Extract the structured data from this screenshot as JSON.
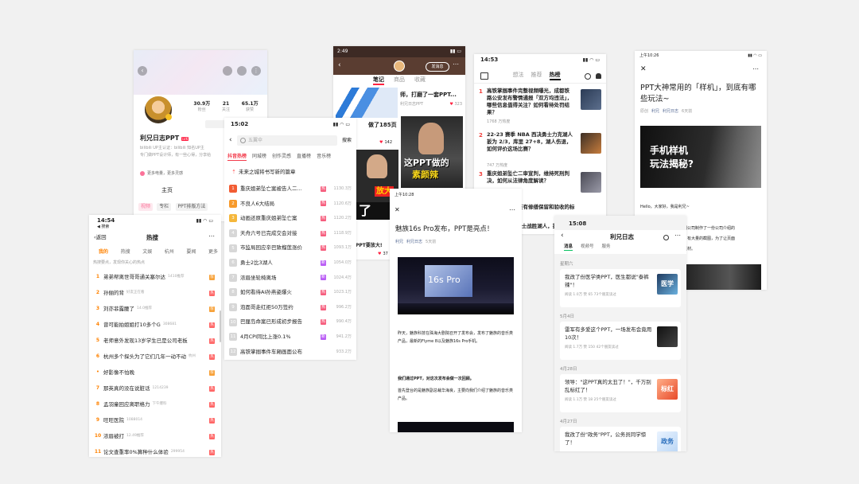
{
  "frame_a": {
    "followers_value": "30.9万",
    "followers_label": "粉丝",
    "following_value": "21",
    "following_label": "关注",
    "likes_value": "65.1万",
    "likes_label": "获赞",
    "name": "利兄日志PPT",
    "level": "LV6",
    "sent_label": "已",
    "desc1": "bilibili UP主认证：bilibili 知名UP主",
    "desc2": "专门做PPT设计师，有一些心得，分享给",
    "notice": "更多电量，更多灵感",
    "tab_home": "主页",
    "tab_dynamic": "动态",
    "chip_video": "视频",
    "chip_column": "专栏",
    "chip_ppt": "PPT排版方法"
  },
  "frame_b": {
    "time": "2:49",
    "follow": "发消息",
    "tab_notes": "笔记",
    "tab_goods": "商品",
    "tab_collect": "收藏",
    "post1_title": "师，打磨了一套PPT...",
    "post1_author": "利兄日志PPT",
    "post1_likes": "323",
    "post2_title": "做了185页",
    "post2_likes": "142",
    "post3_overlay": "这PPT做的",
    "post3_overlay2": "素颜辣",
    "side_red": "放大",
    "side_black": "了",
    "post4_title": "PPT要放大!",
    "post4_likes": "37"
  },
  "frame_c": {
    "time": "14:53",
    "tab_idea": "想法",
    "tab_rec": "推荐",
    "tab_hot": "热榜",
    "items": [
      {
        "rank": "1",
        "title": "高铁掌掴事件完整视频曝光，成都铁路公安发布警情通报「双方均违法」，哪些信息值得关注？如何看待处罚结果？",
        "heat": "1768 万热度"
      },
      {
        "rank": "2",
        "title": "22-23 赛季 NBA 西决勇士力克湖人扳为 2/3，库里 27+8，湖人伤退，如何评价这场比赛？",
        "heat": "747 万热度"
      },
      {
        "rank": "3",
        "title": "重庆姐弟坠亡二审宣判，维持死刑判决，如何从法律角度解读？",
        "heat": ""
      },
      {
        "rank": "4",
        "title": "被砸的小区，还有修缮保留和验收的标准",
        "heat": ""
      },
      {
        "rank": "5",
        "title": "NBA 半决赛勇士战胜湖人，扳回一局，库里",
        "heat": ""
      }
    ]
  },
  "frame_d": {
    "time": "上午10:26",
    "title": "PPT大神常用的「样机」，到底有哪些玩法~",
    "source": "原创",
    "author": "利兄",
    "account": "利兄日志",
    "date": "6天前",
    "cover_line1": "手机样机",
    "cover_line2": "玩法揭秘?",
    "body1": "Hello，大家好，我是利兄~",
    "body2": "网公司制作了一份公司介绍的",
    "body3": "，有大量的截图，为了让页面",
    "body4": "素材。"
  },
  "frame_e": {
    "time": "15:02",
    "search_placeholder": "五翼伞",
    "search_btn": "搜索",
    "tabs": [
      "抖音热榜",
      "同城榜",
      "创作灵感",
      "直播榜",
      "音乐榜"
    ],
    "top_item": "未来之城将书写新的篇章",
    "items": [
      {
        "rank": "1",
        "title": "重庆姐弟坠亡案被告人二...",
        "heat": "1130.3万",
        "badge": "热"
      },
      {
        "rank": "2",
        "title": "不良人6大结局",
        "heat": "1120.6万",
        "badge": "热"
      },
      {
        "rank": "3",
        "title": "动画还原重庆姐弟坠亡案",
        "heat": "1120.2万",
        "badge": "热"
      },
      {
        "rank": "4",
        "title": "天舟六号已完成交会对接",
        "heat": "1118.9万",
        "badge": "热"
      },
      {
        "rank": "5",
        "title": "市监局回应辛巴致榴莲涨价",
        "heat": "1093.1万",
        "badge": "热"
      },
      {
        "rank": "6",
        "title": "勇士2比3湖人",
        "heat": "1054.0万",
        "badge": "新"
      },
      {
        "rank": "7",
        "title": "浓眉坐轮椅离场",
        "heat": "1024.4万",
        "badge": "新"
      },
      {
        "rank": "8",
        "title": "如何看待AI孙燕姿爆火",
        "heat": "1023.1万",
        "badge": "热"
      },
      {
        "rank": "9",
        "title": "泡面哥走红拒50万签约",
        "heat": "996.2万",
        "badge": "热"
      },
      {
        "rank": "10",
        "title": "巴厘岛命案已形成初步报告",
        "heat": "990.4万",
        "badge": "热"
      },
      {
        "rank": "11",
        "title": "4月CPI同比上涨0.1%",
        "heat": "941.2万",
        "badge": "新"
      },
      {
        "rank": "12",
        "title": "高铁掌掴事件车厢画面公布",
        "heat": "933.2万",
        "badge": ""
      }
    ]
  },
  "frame_f": {
    "time": "14:54",
    "carrier": "◀ 搜索",
    "back": "返回",
    "title": "热搜",
    "tabs": [
      "我的",
      "热搜",
      "文娱",
      "杭州",
      "要闻",
      "更多"
    ],
    "subtitle": "热搜要点，发现你关心的热点",
    "items": [
      {
        "rank": "1",
        "title": "弟弟帮离世哥哥通关塞尔达",
        "meta": "1410推荐",
        "badge": "荐",
        "dot": false
      },
      {
        "rank": "2",
        "title": "孙俪的背",
        "meta": "好友正在看",
        "badge": "热",
        "dot": false
      },
      {
        "rank": "3",
        "title": "刘亦菲露腰了",
        "meta": "14.0推荐",
        "badge": "荐",
        "dot": false
      },
      {
        "rank": "4",
        "title": "曾可能拍姐姐打10多个G",
        "meta": "308681",
        "badge": "热",
        "dot": false
      },
      {
        "rank": "5",
        "title": "老师意外发现13岁学生已是公司老板",
        "meta": "",
        "badge": "热",
        "dot": false
      },
      {
        "rank": "6",
        "title": "杭州多个探头为了它们几年一动不动",
        "meta": "杭州",
        "badge": "热",
        "dot": false
      },
      {
        "rank": "",
        "title": "好影像不怕晚",
        "meta": "",
        "badge": "荐",
        "dot": true
      },
      {
        "rank": "7",
        "title": "那英真的没在说脏话",
        "meta": "1214239",
        "badge": "热",
        "dot": false
      },
      {
        "rank": "8",
        "title": "孟羽童回应离职格力",
        "meta": "下午爆料",
        "badge": "热",
        "dot": false
      },
      {
        "rank": "9",
        "title": "旺旺医院",
        "meta": "1088014",
        "badge": "热",
        "dot": false
      },
      {
        "rank": "10",
        "title": "浓眉被打",
        "meta": "12.49推荐",
        "badge": "热",
        "dot": false
      },
      {
        "rank": "11",
        "title": "论文查重率0%算种什么体验",
        "meta": "299954",
        "badge": "热",
        "dot": false
      }
    ]
  },
  "frame_g": {
    "time": "上午10:28",
    "title": "魅族16s Pro发布，PPT是亮点！",
    "author": "利兄",
    "account": "利兄日志",
    "date": "5天前",
    "screen_text": "16s Pro",
    "p1": "昨天，魅族科技在珠海大剧院召开了发布会，发布了魅族的音乐类产品，最新的Flyme 8以及魅族16s Pro手机。",
    "p2": "我们通过PPT，对这次发布会做一次回顾。",
    "p3": "首先登台的是魅族副总裁华海良，主要向我们介绍了魅族的音乐类产品。"
  },
  "frame_h": {
    "time": "15:08",
    "title": "利兄日志",
    "tabs": [
      "消息",
      "视频号",
      "服务"
    ],
    "groups": [
      {
        "date": "星期六",
        "title": "我改了份医学类PPT，医生都说\"泰裤辣\"！",
        "meta": "阅读 1.0万  赞 65  73个朋友读过",
        "thumb": "医学"
      },
      {
        "date": "5月4日",
        "title": "雷军有多爱这个PPT，一场发布会竟用10次！",
        "meta": "阅读 1.7万  赞 150  42个朋友读过",
        "thumb": ""
      },
      {
        "date": "4月28日",
        "title": "领导：\"这PPT真的太丑了！\"，千万别乱标红了！",
        "meta": "阅读 1.1万  赞 18  25个朋友读过",
        "thumb": "标红"
      },
      {
        "date": "4月27日",
        "title": "我改了份\"政务\"PPT，公务员同学惊了！",
        "meta": "",
        "thumb": "政务"
      }
    ]
  }
}
